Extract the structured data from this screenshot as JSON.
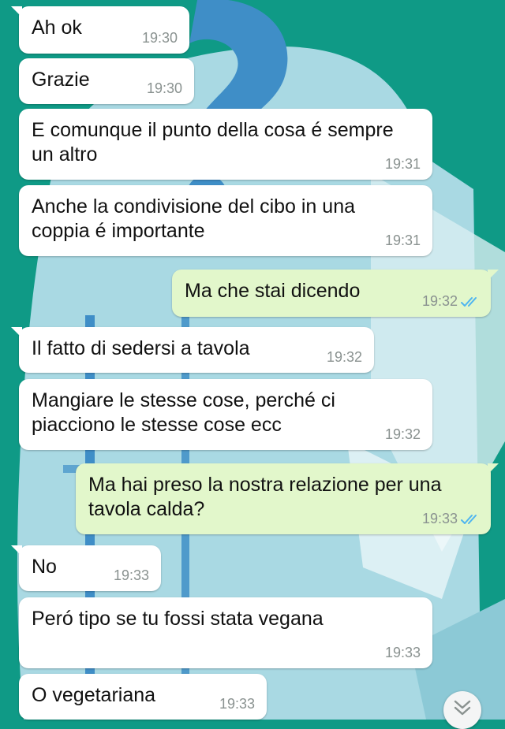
{
  "colors": {
    "wallpaper": "#0f9a86",
    "incoming_bubble": "#ffffff",
    "outgoing_bubble": "#e2f7cb",
    "read_ticks": "#4fb5f0",
    "timestamp": "#8a9290"
  },
  "messages": [
    {
      "direction": "in",
      "text": "Ah ok",
      "time": "19:30",
      "tail": true
    },
    {
      "direction": "in",
      "text": "Grazie",
      "time": "19:30",
      "tail": false
    },
    {
      "direction": "in",
      "text": "E comunque il punto della cosa é sempre\nun altro",
      "time": "19:31",
      "tail": false
    },
    {
      "direction": "in",
      "text": "Anche la condivisione del cibo in una\ncoppia é importante",
      "time": "19:31",
      "tail": false
    },
    {
      "direction": "out",
      "text": "Ma che stai dicendo",
      "time": "19:32",
      "tail": true,
      "status": "read"
    },
    {
      "direction": "in",
      "text": "Il fatto di sedersi a tavola",
      "time": "19:32",
      "tail": true
    },
    {
      "direction": "in",
      "text": "Mangiare le stesse cose, perché ci\npiacciono le stesse cose ecc",
      "time": "19:32",
      "tail": false
    },
    {
      "direction": "out",
      "text": "Ma hai preso la nostra relazione per una\ntavola calda?",
      "time": "19:33",
      "tail": true,
      "status": "read"
    },
    {
      "direction": "in",
      "text": "No",
      "time": "19:33",
      "tail": true
    },
    {
      "direction": "in",
      "text": "Peró tipo se tu fossi stata vegana",
      "time": "19:33",
      "tail": false
    },
    {
      "direction": "in",
      "text": "O vegetariana",
      "time": "19:33",
      "tail": false
    }
  ],
  "scroll_button": {
    "icon": "double-chevron-down-icon"
  }
}
